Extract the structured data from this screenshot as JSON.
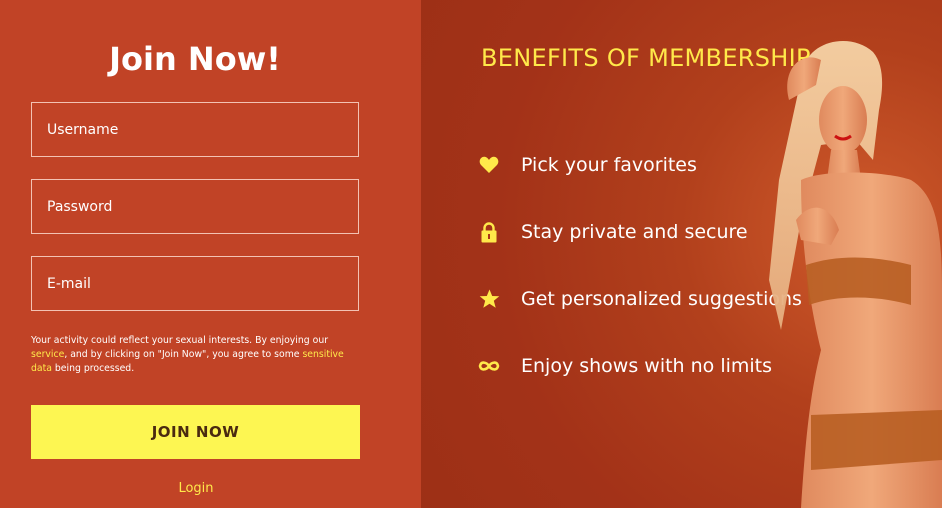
{
  "form": {
    "title": "Join Now!",
    "username_placeholder": "Username",
    "password_placeholder": "Password",
    "email_placeholder": "E-mail",
    "disclaimer": {
      "part1": "Your activity could reflect your sexual interests. By enjoying our ",
      "service_link": "service",
      "part2": ", and by clicking on \"Join Now\", you agree to some ",
      "sensitive_link": "sensitive data",
      "part3": " being processed."
    },
    "join_button": "JOIN NOW",
    "login_link": "Login"
  },
  "benefits": {
    "title": "BENEFITS OF MEMBERSHIP",
    "items": [
      {
        "icon": "heart-icon",
        "label": "Pick your favorites"
      },
      {
        "icon": "lock-icon",
        "label": "Stay private and secure"
      },
      {
        "icon": "star-icon",
        "label": "Get personalized suggestions"
      },
      {
        "icon": "infinity-icon",
        "label": "Enjoy shows with no limits"
      }
    ]
  },
  "colors": {
    "left_bg": "#c14326",
    "right_bg": "#a93418",
    "accent_yellow": "#ffe94a",
    "button_yellow": "#fdf652"
  }
}
